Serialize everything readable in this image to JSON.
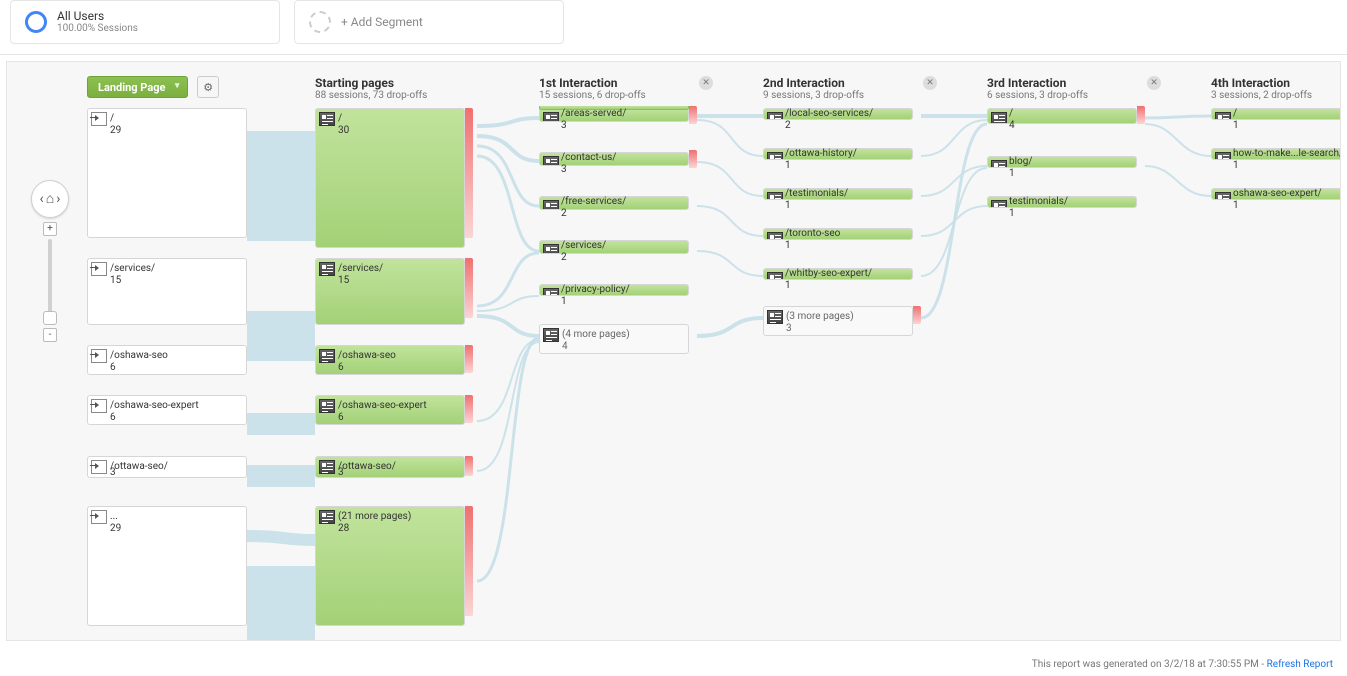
{
  "segments": {
    "active": {
      "title": "All Users",
      "subtitle": "100.00% Sessions"
    },
    "add": {
      "label": "+ Add Segment"
    }
  },
  "landing_button": "Landing Page",
  "columns": {
    "landing": {
      "title": "",
      "sub": ""
    },
    "start": {
      "title": "Starting pages",
      "sub": "88 sessions, 73 drop-offs"
    },
    "int1": {
      "title": "1st Interaction",
      "sub": "15 sessions, 6 drop-offs"
    },
    "int2": {
      "title": "2nd Interaction",
      "sub": "9 sessions, 3 drop-offs"
    },
    "int3": {
      "title": "3rd Interaction",
      "sub": "6 sessions, 3 drop-offs"
    },
    "int4": {
      "title": "4th Interaction",
      "sub": "3 sessions, 2 drop-offs"
    }
  },
  "landing_nodes": [
    {
      "label": "/",
      "count": "29"
    },
    {
      "label": "/services/",
      "count": "15"
    },
    {
      "label": "/oshawa-seo",
      "count": "6"
    },
    {
      "label": "/oshawa-seo-expert",
      "count": "6"
    },
    {
      "label": "/ottawa-seo/",
      "count": "3"
    },
    {
      "label": "...",
      "count": "29"
    }
  ],
  "start_nodes": [
    {
      "label": "/",
      "count": "30"
    },
    {
      "label": "/services/",
      "count": "15"
    },
    {
      "label": "/oshawa-seo",
      "count": "6"
    },
    {
      "label": "/oshawa-seo-expert",
      "count": "6"
    },
    {
      "label": "/ottawa-seo/",
      "count": "3"
    },
    {
      "label": "(21 more pages)",
      "count": "28"
    }
  ],
  "int1_nodes": [
    {
      "label": "/areas-served/",
      "count": "3"
    },
    {
      "label": "/contact-us/",
      "count": "3"
    },
    {
      "label": "/free-services/",
      "count": "2"
    },
    {
      "label": "/services/",
      "count": "2"
    },
    {
      "label": "/privacy-policy/",
      "count": "1"
    },
    {
      "label": "(4 more pages)",
      "count": "4",
      "ghost": true
    }
  ],
  "int2_nodes": [
    {
      "label": "/local-seo-services/",
      "count": "2"
    },
    {
      "label": "/ottawa-history/",
      "count": "1"
    },
    {
      "label": "/testimonials/",
      "count": "1"
    },
    {
      "label": "/toronto-seo",
      "count": "1"
    },
    {
      "label": "/whitby-seo-expert/",
      "count": "1"
    },
    {
      "label": "(3 more pages)",
      "count": "3",
      "ghost": true
    }
  ],
  "int3_nodes": [
    {
      "label": "/",
      "count": "4"
    },
    {
      "label": "blog/",
      "count": "1"
    },
    {
      "label": "testimonials/",
      "count": "1"
    }
  ],
  "int4_nodes": [
    {
      "label": "/",
      "count": "1"
    },
    {
      "label": "how-to-make...le-search/",
      "count": "1"
    },
    {
      "label": "oshawa-seo-expert/",
      "count": "1"
    }
  ],
  "footer": {
    "text": "This report was generated on 3/2/18 at 7:30:55 PM - ",
    "link": "Refresh Report"
  }
}
